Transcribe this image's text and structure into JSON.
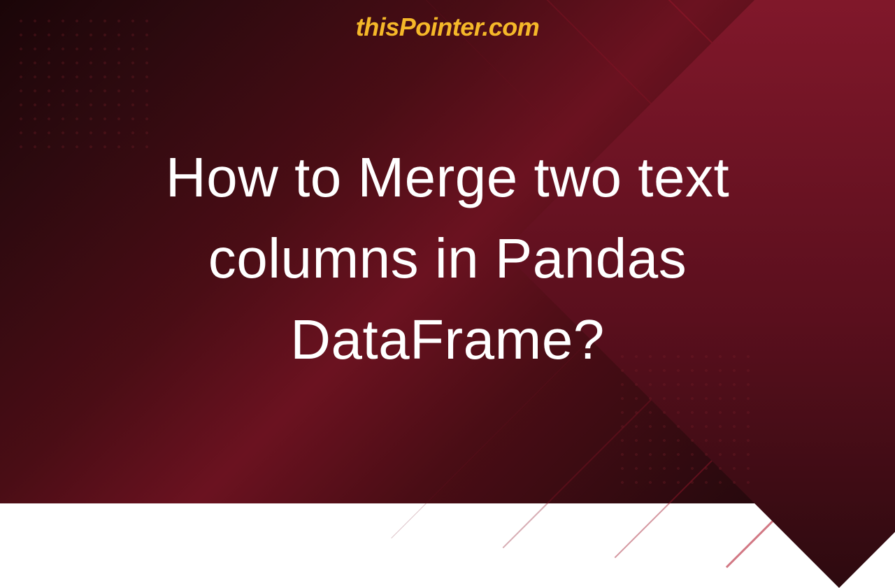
{
  "brand": {
    "name": "thisPointer.com"
  },
  "headline": {
    "text": "How to Merge two text columns in Pandas DataFrame?"
  },
  "colors": {
    "brand_accent": "#f5b829",
    "text": "#ffffff"
  }
}
